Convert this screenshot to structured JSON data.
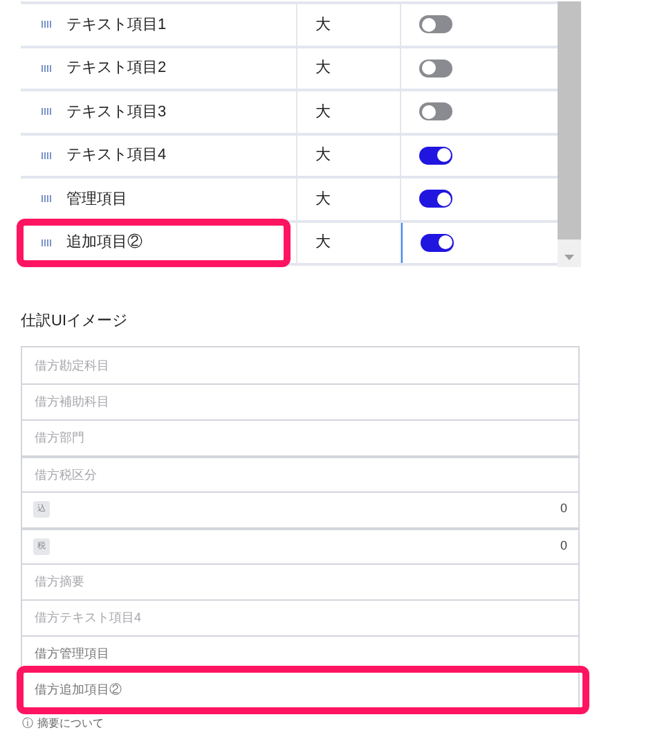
{
  "settings_table": {
    "rows": [
      {
        "name": "テキスト項目1",
        "size": "大",
        "on": false,
        "highlighted": false
      },
      {
        "name": "テキスト項目2",
        "size": "大",
        "on": false,
        "highlighted": false
      },
      {
        "name": "テキスト項目3",
        "size": "大",
        "on": false,
        "highlighted": false
      },
      {
        "name": "テキスト項目4",
        "size": "大",
        "on": true,
        "highlighted": false
      },
      {
        "name": "管理項目",
        "size": "大",
        "on": true,
        "highlighted": false
      },
      {
        "name": "追加項目②",
        "size": "大",
        "on": true,
        "highlighted": true
      }
    ]
  },
  "preview": {
    "title": "仕訳UIイメージ",
    "fields": [
      {
        "kind": "text",
        "placeholder": "借方勘定科目",
        "highlighted": false
      },
      {
        "kind": "text",
        "placeholder": "借方補助科目",
        "highlighted": false
      },
      {
        "kind": "text",
        "placeholder": "借方部門",
        "highlighted": false
      },
      {
        "kind": "text",
        "placeholder": "借方税区分",
        "highlighted": false
      },
      {
        "kind": "amount",
        "badge": "込",
        "value": "0",
        "highlighted": false
      },
      {
        "kind": "amount",
        "badge": "税",
        "value": "0",
        "highlighted": false
      },
      {
        "kind": "text",
        "placeholder": "借方摘要",
        "highlighted": false
      },
      {
        "kind": "text",
        "placeholder": "借方テキスト項目4",
        "highlighted": false
      },
      {
        "kind": "label",
        "placeholder": "借方管理項目",
        "highlighted": false
      },
      {
        "kind": "label",
        "placeholder": "借方追加項目②",
        "highlighted": true
      }
    ],
    "note": {
      "icon": "ⓘ",
      "text": "摘要について"
    }
  }
}
